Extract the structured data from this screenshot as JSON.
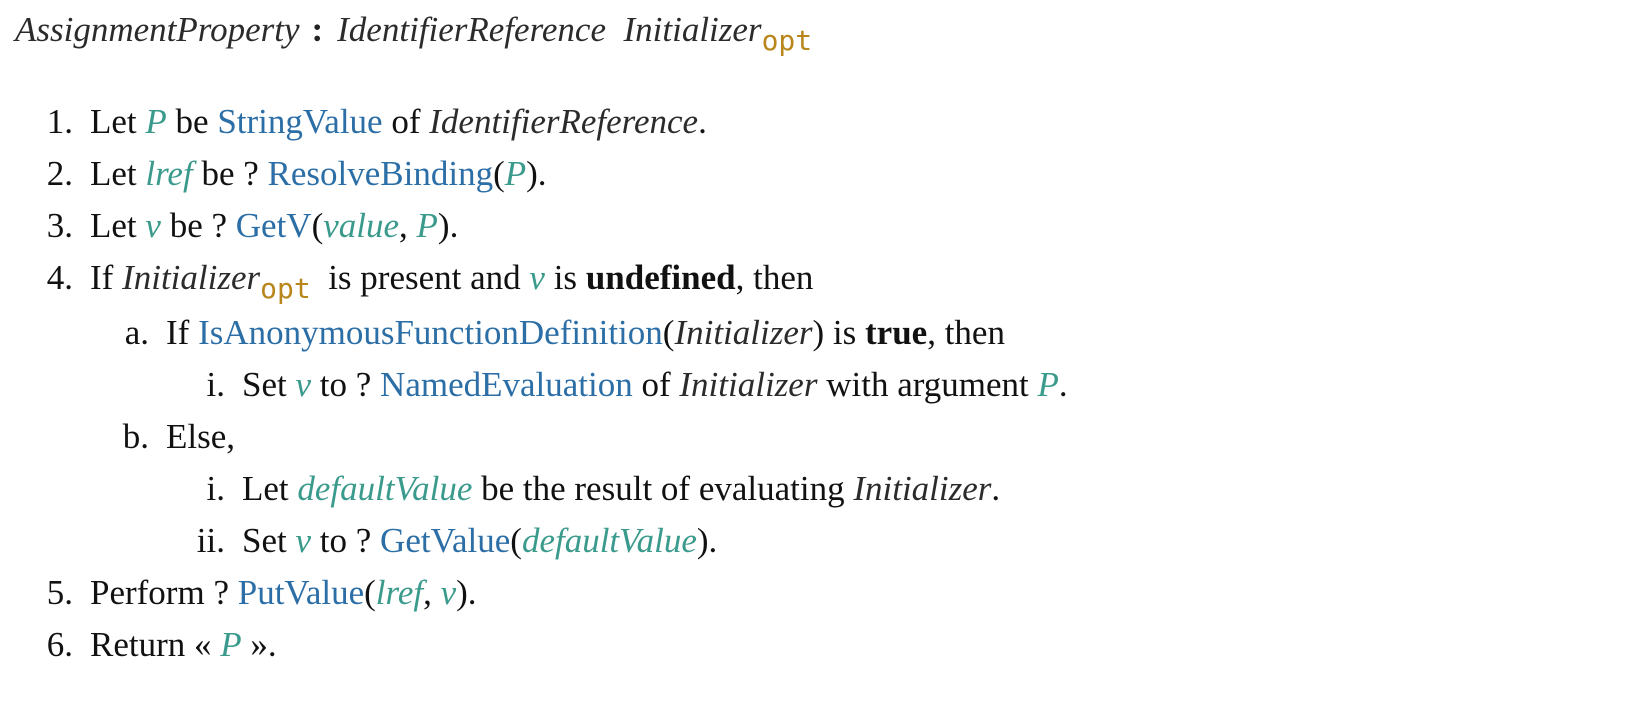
{
  "production": {
    "lhs": "AssignmentProperty",
    "colon": ":",
    "rhs1": "IdentifierReference",
    "rhs2": "Initializer",
    "opt": "opt"
  },
  "steps": {
    "s1": {
      "num": "1.",
      "t1": "Let ",
      "var_p": "P",
      "t2": " be ",
      "op": "StringValue",
      "t3": " of ",
      "nt": "IdentifierReference",
      "t4": "."
    },
    "s2": {
      "num": "2.",
      "t1": "Let ",
      "var": "lref",
      "t2": " be ? ",
      "op": "ResolveBinding",
      "t3": "(",
      "var_p": "P",
      "t4": ")."
    },
    "s3": {
      "num": "3.",
      "t1": "Let ",
      "var_v": "v",
      "t2": " be ? ",
      "op": "GetV",
      "t3": "(",
      "var_value": "value",
      "t4": ", ",
      "var_p": "P",
      "t5": ")."
    },
    "s4": {
      "num": "4.",
      "t1": "If ",
      "nt": "Initializer",
      "opt": "opt",
      "t2": " is present and ",
      "var_v": "v",
      "t3": " is ",
      "b": "undefined",
      "t4": ", then"
    },
    "s4a": {
      "num": "a.",
      "t1": "If ",
      "op": "IsAnonymousFunctionDefinition",
      "t2": "(",
      "nt": "Initializer",
      "t3": ") is ",
      "b": "true",
      "t4": ", then"
    },
    "s4ai": {
      "num": "i.",
      "t1": "Set ",
      "var_v": "v",
      "t2": " to ? ",
      "op": "NamedEvaluation",
      "t3": " of ",
      "nt": "Initializer",
      "t4": " with argument ",
      "var_p": "P",
      "t5": "."
    },
    "s4b": {
      "num": "b.",
      "t1": "Else,"
    },
    "s4bi": {
      "num": "i.",
      "t1": "Let ",
      "var": "defaultValue",
      "t2": " be the result of evaluating ",
      "nt": "Initializer",
      "t3": "."
    },
    "s4bii": {
      "num": "ii.",
      "t1": "Set ",
      "var_v": "v",
      "t2": " to ? ",
      "op": "GetValue",
      "t3": "(",
      "var": "defaultValue",
      "t4": ")."
    },
    "s5": {
      "num": "5.",
      "t1": "Perform ? ",
      "op": "PutValue",
      "t2": "(",
      "var_lref": "lref",
      "t3": ", ",
      "var_v": "v",
      "t4": ")."
    },
    "s6": {
      "num": "6.",
      "t1": "Return « ",
      "var_p": "P",
      "t2": " »."
    }
  },
  "colors": {
    "variable": "#3a9a8c",
    "operation_link": "#2c6ea6",
    "opt_subscript": "#b8861b",
    "text": "#111111"
  }
}
